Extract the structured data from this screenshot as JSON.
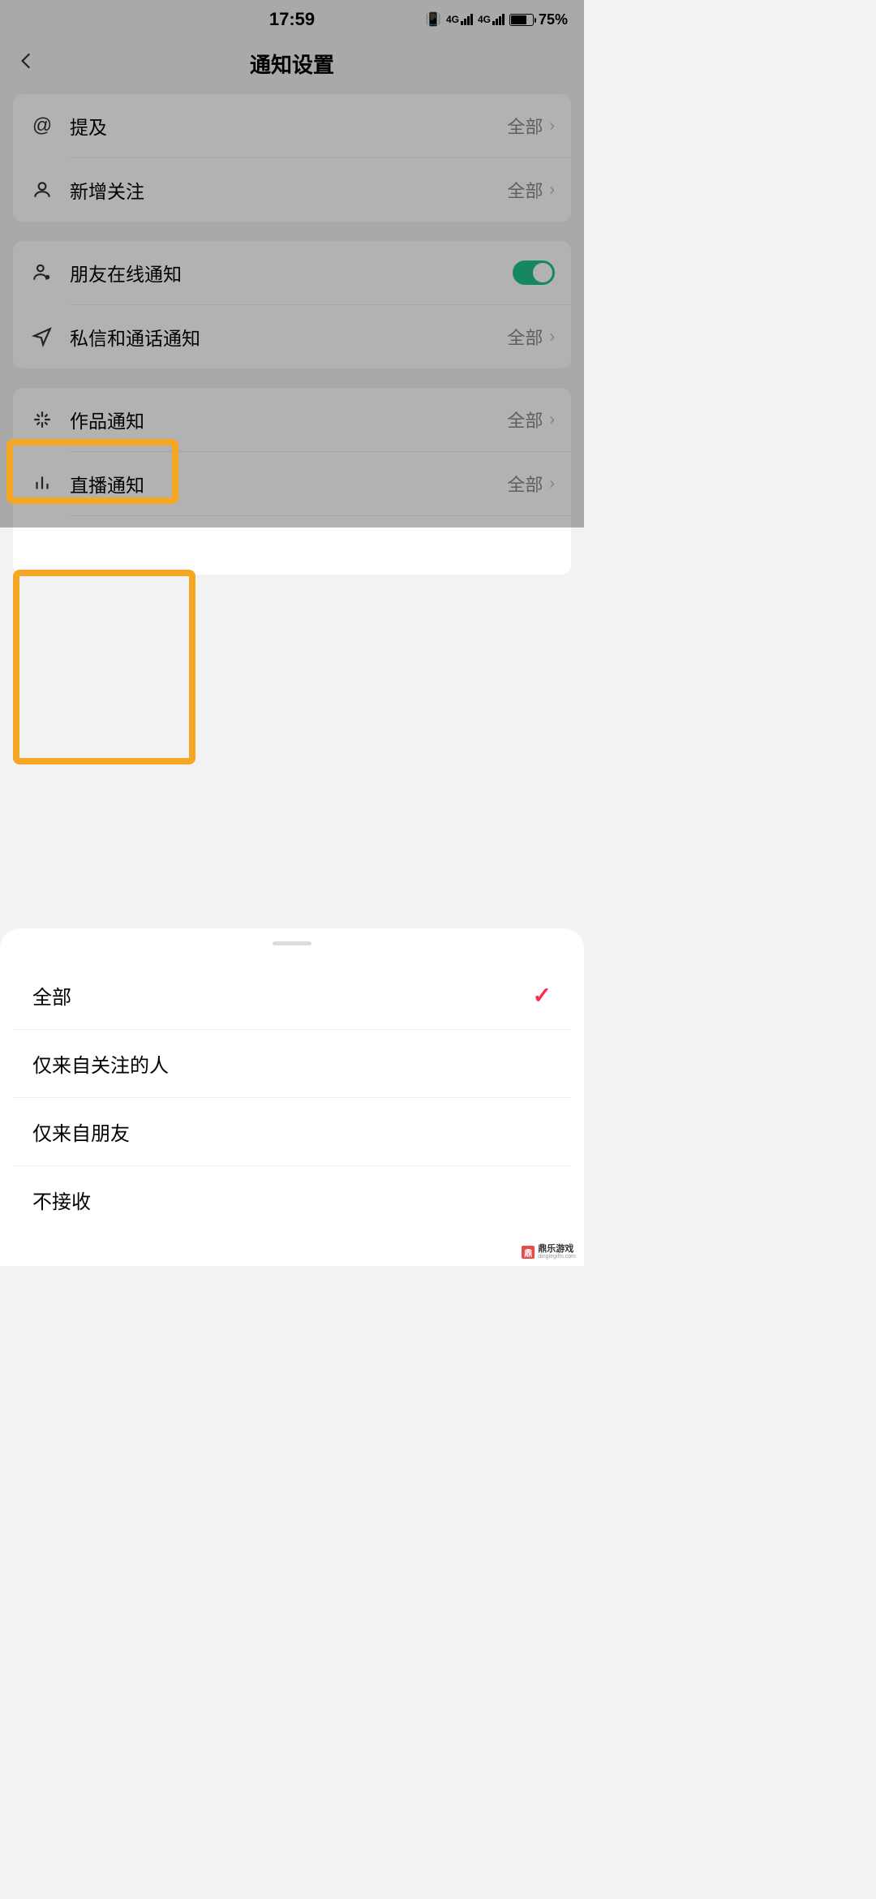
{
  "status": {
    "time": "17:59",
    "network_label": "4G",
    "battery_pct": "75%"
  },
  "header": {
    "title": "通知设置"
  },
  "rows": {
    "mention": {
      "label": "提及",
      "value": "全部"
    },
    "new_follower": {
      "label": "新增关注",
      "value": "全部"
    },
    "friend_online": {
      "label": "朋友在线通知"
    },
    "dm_call": {
      "label": "私信和通话通知",
      "value": "全部"
    },
    "works": {
      "label": "作品通知",
      "value": "全部"
    },
    "live": {
      "label": "直播通知",
      "value": "全部"
    }
  },
  "sheet": {
    "options": {
      "all": "全部",
      "followed": "仅来自关注的人",
      "friends": "仅来自朋友",
      "none": "不接收"
    }
  },
  "watermark": {
    "name": "鼎乐游戏",
    "url": "dinglegifts.com"
  }
}
